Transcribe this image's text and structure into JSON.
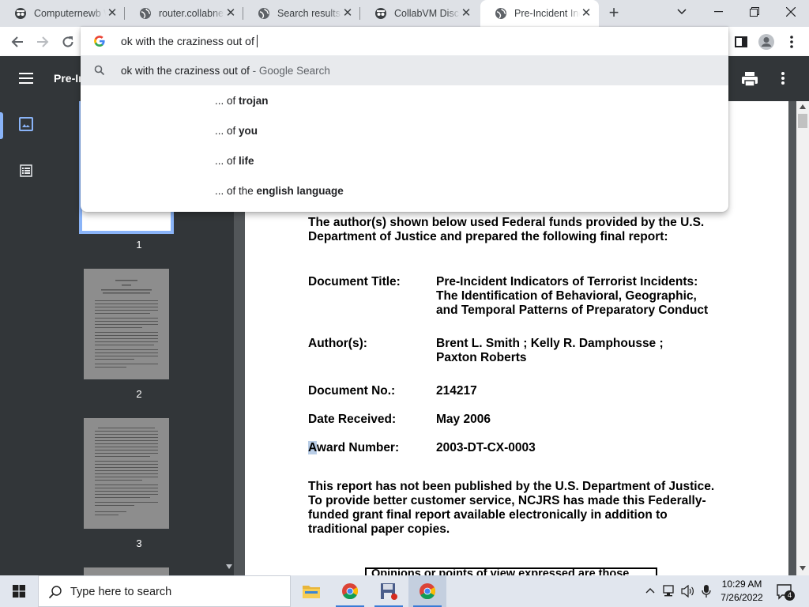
{
  "browser": {
    "tabs": [
      {
        "title": "Computernewb Wiki",
        "favicon": "spy-icon"
      },
      {
        "title": "router.collabnet",
        "favicon": "globe-icon"
      },
      {
        "title": "Search results for",
        "favicon": "globe-icon"
      },
      {
        "title": "CollabVM Discord",
        "favicon": "spy-icon"
      },
      {
        "title": "Pre-Incident Indicators",
        "favicon": "globe-icon",
        "active": true
      }
    ],
    "new_tab_label": "+",
    "omnibox": {
      "value": "ok with the craziness out of",
      "suggestions": [
        {
          "prefix": "ok with the craziness out of",
          "suffix": " - Google Search",
          "type": "search"
        },
        {
          "lead": "... o",
          "mid": "f ",
          "bold": "trojan",
          "type": "completion"
        },
        {
          "lead": "... o",
          "mid": "f ",
          "bold": "you",
          "type": "completion"
        },
        {
          "lead": "... o",
          "mid": "f ",
          "bold": "life",
          "type": "completion"
        },
        {
          "lead": "... o",
          "mid": "f the ",
          "bold": "english language",
          "type": "completion"
        }
      ]
    }
  },
  "pdf": {
    "title": "Pre-In",
    "thumbnails": [
      {
        "page": "1"
      },
      {
        "page": "2"
      },
      {
        "page": "3"
      }
    ],
    "content": {
      "intro_line1": "The author(s) shown below used Federal funds provided by the U.S.",
      "intro_line2": "Department of Justice and prepared the following final report:",
      "fields": {
        "doc_title_label": "Document Title:",
        "doc_title_l1": "Pre-Incident Indicators of Terrorist Incidents:",
        "doc_title_l2": "The Identification of Behavioral, Geographic,",
        "doc_title_l3": "and Temporal Patterns of Preparatory Conduct",
        "authors_label": "Author(s):",
        "authors_l1": "Brent L. Smith ; Kelly R. Damphousse ;",
        "authors_l2": "Paxton Roberts",
        "doc_no_label": "Document No.:",
        "doc_no": "214217",
        "date_label": "Date Received:",
        "date": "May 2006",
        "award_label_first": "A",
        "award_label_rest": "ward Number:",
        "award": "2003-DT-CX-0003"
      },
      "notice_l1": "This report has not been published by the U.S. Department of Justice.",
      "notice_l2": "To provide better customer service, NCJRS has made this Federally-",
      "notice_l3": "funded grant final report available electronically in addition to",
      "notice_l4": "traditional paper copies.",
      "opinion_partial": "Opinions or points of view expressed are those"
    }
  },
  "taskbar": {
    "search_placeholder": "Type here to search",
    "time": "10:29 AM",
    "date": "7/26/2022",
    "notification_count": "4"
  },
  "colors": {
    "tabstrip": "#dee1e6",
    "pdf_toolbar": "#323639",
    "viewer_bg": "#525659",
    "rail_accent": "#8ab4f8"
  }
}
